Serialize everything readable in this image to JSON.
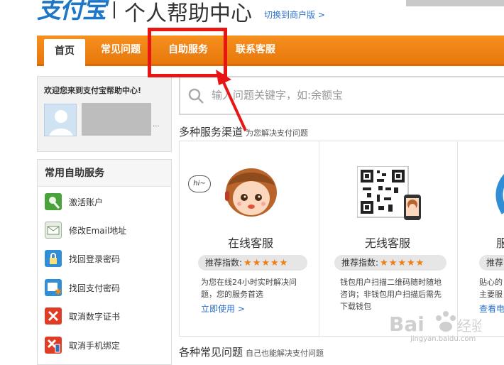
{
  "header": {
    "logo_text": "支付宝",
    "title": "个人帮助中心",
    "switch_link": "切换到商户版 >"
  },
  "nav": {
    "tabs": [
      {
        "label": "首页",
        "active": true
      },
      {
        "label": "常见问题",
        "active": false
      },
      {
        "label": "自助服务",
        "active": false
      },
      {
        "label": "联系客服",
        "active": false
      }
    ]
  },
  "welcome": {
    "text": "欢迎您来到支付宝帮助中心!",
    "ellipsis": "..."
  },
  "services": {
    "title": "常用自助服务",
    "items": [
      {
        "label": "激活账户",
        "icon": "activate-account-icon",
        "color": "#49a23a"
      },
      {
        "label": "修改Email地址",
        "icon": "email-edit-icon",
        "color": "#6a9b57"
      },
      {
        "label": "找回登录密码",
        "icon": "login-password-icon",
        "color": "#2f8ed6"
      },
      {
        "label": "找回支付密码",
        "icon": "pay-password-icon",
        "color": "#2f8ed6"
      },
      {
        "label": "取消数字证书",
        "icon": "cancel-certificate-icon",
        "color": "#e03b24"
      },
      {
        "label": "取消手机绑定",
        "icon": "cancel-phone-icon",
        "color": "#e03b24"
      }
    ]
  },
  "search": {
    "placeholder": "输入问题关键字，如:余额宝"
  },
  "channels_section": {
    "title": "多种服务渠道",
    "subtitle": "为您解决支付问题"
  },
  "channels": [
    {
      "title": "在线客服",
      "rating_label": "推荐指数:",
      "stars": "★★★★★",
      "description": [
        "为您在线24小时实时解决问",
        "题，您的服务首选"
      ],
      "link": "立即使用 >",
      "bubble": "hi~"
    },
    {
      "title": "无线客服",
      "rating_label": "推荐指数:",
      "stars": "★★★★★",
      "description": [
        "钱包用户扫描二维码随时随地",
        "咨询；非钱包用户扫描后需先",
        "下载钱包"
      ]
    },
    {
      "title": "服",
      "rating_label": "推荐",
      "description": [
        "贴心的",
        "主要服"
      ],
      "link": "查看电"
    }
  ],
  "faq_section": {
    "title": "各种常见问题",
    "subtitle": "自己也能解决支付问题"
  },
  "watermark": {
    "text": "Bai",
    "text2": "经验",
    "sub": "jingyan.baidu.com"
  },
  "colors": {
    "nav_orange": "#f08a17",
    "highlight_red": "#e81515",
    "link_blue": "#2a6fc9",
    "star_orange": "#f07d0e"
  }
}
